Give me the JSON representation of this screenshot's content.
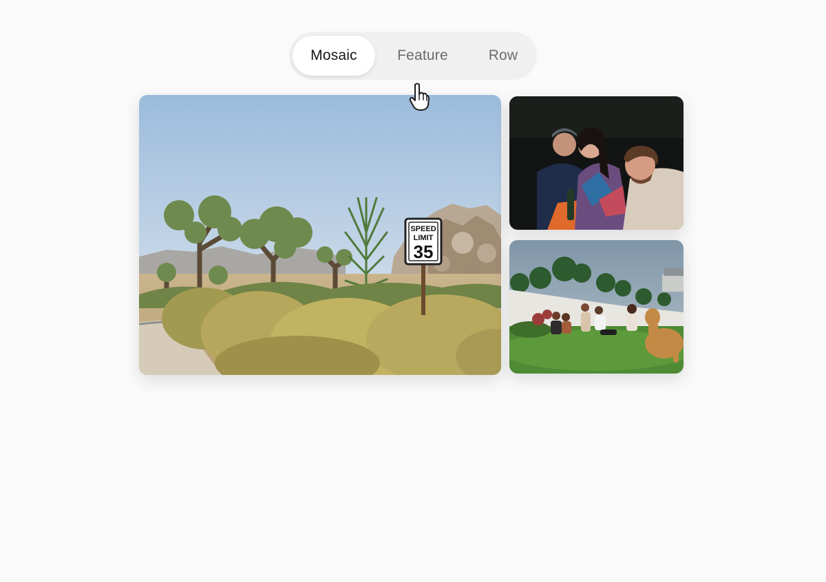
{
  "layout_switcher": {
    "tabs": [
      {
        "label": "Mosaic",
        "active": true
      },
      {
        "label": "Feature",
        "active": false
      },
      {
        "label": "Row",
        "active": false
      }
    ]
  },
  "gallery": {
    "photos": [
      {
        "subject": "desert landscape with joshua trees and road sign",
        "sign": {
          "line1": "SPEED",
          "line2": "LIMIT",
          "line3": "35"
        }
      },
      {
        "subject": "three friends taking a selfie at night"
      },
      {
        "subject": "group of friends with a dog on a lawn"
      }
    ]
  },
  "cursor": {
    "icon": "hand-pointer-icon"
  }
}
